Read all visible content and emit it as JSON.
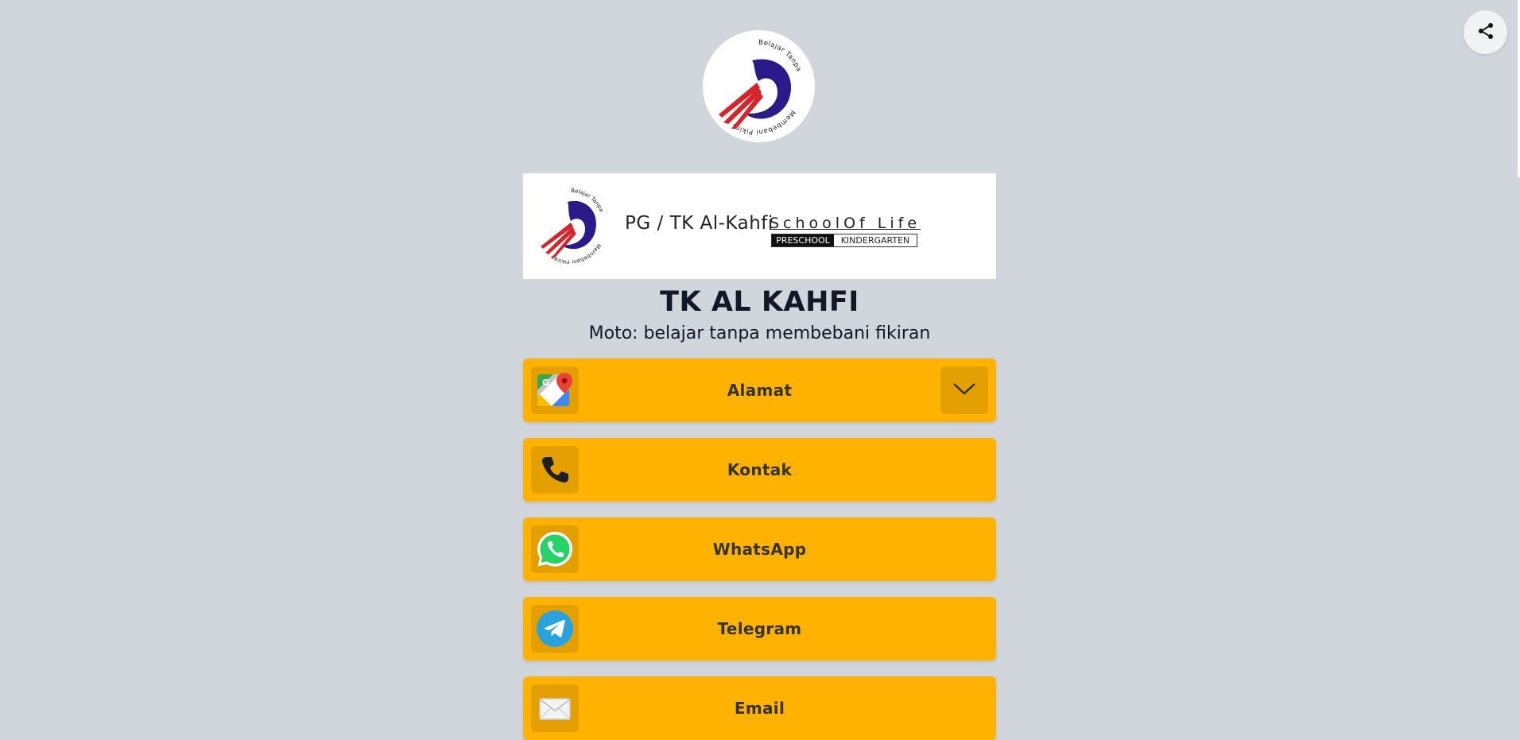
{
  "share": {
    "icon": "share-icon"
  },
  "profile": {
    "logo_alt": "Belajar Tanpa Membebani Pikiran"
  },
  "banner": {
    "school_name": "PG / TK Al-Kahfi",
    "tagline": "SchoolOf Life",
    "tag_preschool": "PRESCHOOL",
    "tag_kindergarten": "KINDERGARTEN",
    "logo_text": "Belajar Tanpa Membebani Pikiran"
  },
  "header": {
    "title": "TK AL KAHFI",
    "subtitle": "Moto: belajar tanpa membebani fikiran"
  },
  "links": [
    {
      "label": "Alamat",
      "icon": "google-maps-icon",
      "expandable": true
    },
    {
      "label": "Kontak",
      "icon": "phone-icon"
    },
    {
      "label": "WhatsApp",
      "icon": "whatsapp-icon"
    },
    {
      "label": "Telegram",
      "icon": "telegram-icon"
    },
    {
      "label": "Email",
      "icon": "email-icon"
    }
  ],
  "colors": {
    "background": "#d1d5dc",
    "button": "#ffb300",
    "button_icon_bg": "#e3a000",
    "logo_navy": "#2a1a8a",
    "logo_red": "#d7262b"
  }
}
